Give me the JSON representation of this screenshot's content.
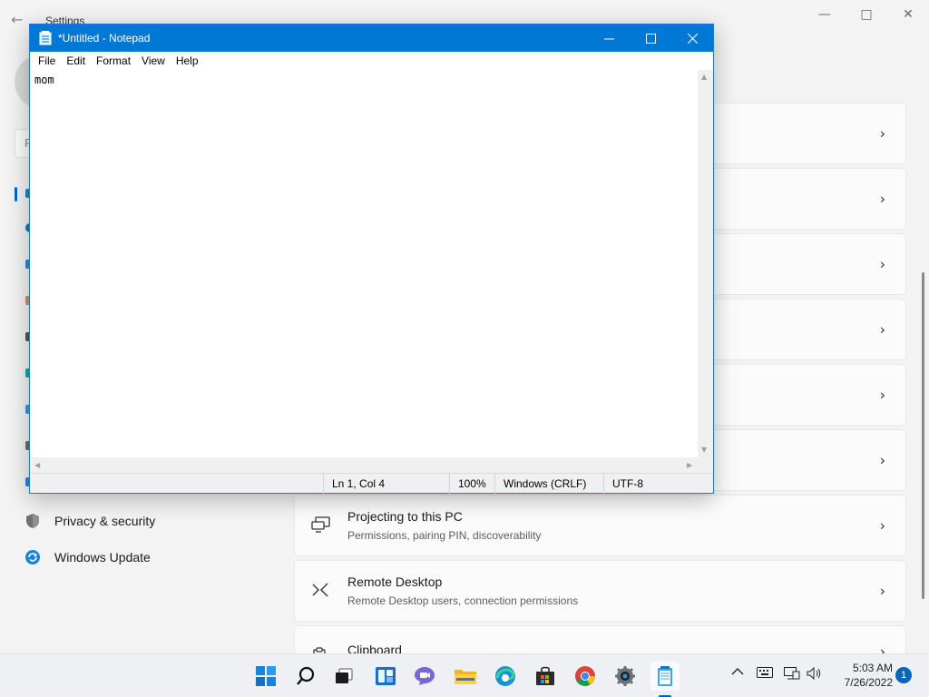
{
  "settings": {
    "title": "Settings",
    "search_placeholder": "F",
    "nav": [
      {
        "label": "Privacy & security",
        "icon": "shield-icon"
      },
      {
        "label": "Windows Update",
        "icon": "update-icon"
      }
    ],
    "cards": [
      {
        "title": "Projecting to this PC",
        "subtitle": "Permissions, pairing PIN, discoverability",
        "icon": "projector-icon"
      },
      {
        "title": "Remote Desktop",
        "subtitle": "Remote Desktop users, connection permissions",
        "icon": "remote-desktop-icon"
      },
      {
        "title": "Clipboard",
        "subtitle": "",
        "icon": "clipboard-icon"
      }
    ],
    "chevron": "›",
    "caption": {
      "minimize": "—",
      "maximize": "□",
      "close": "✕"
    }
  },
  "notepad": {
    "title": "*Untitled - Notepad",
    "menu": [
      "File",
      "Edit",
      "Format",
      "View",
      "Help"
    ],
    "content": "mom",
    "status": {
      "position": "Ln 1, Col 4",
      "zoom": "100%",
      "line_ending": "Windows (CRLF)",
      "encoding": "UTF-8"
    },
    "caption": {
      "minimize": "—",
      "maximize": "□",
      "close": "✕"
    },
    "accent": "#0078d4"
  },
  "taskbar": {
    "apps": [
      "start-icon",
      "search-icon",
      "task-view-icon",
      "widgets-icon",
      "chat-icon",
      "file-explorer-icon",
      "edge-icon",
      "store-icon",
      "chrome-icon",
      "settings-icon",
      "notepad-icon"
    ],
    "time": "5:03 AM",
    "date": "7/26/2022",
    "notification_count": "1"
  }
}
